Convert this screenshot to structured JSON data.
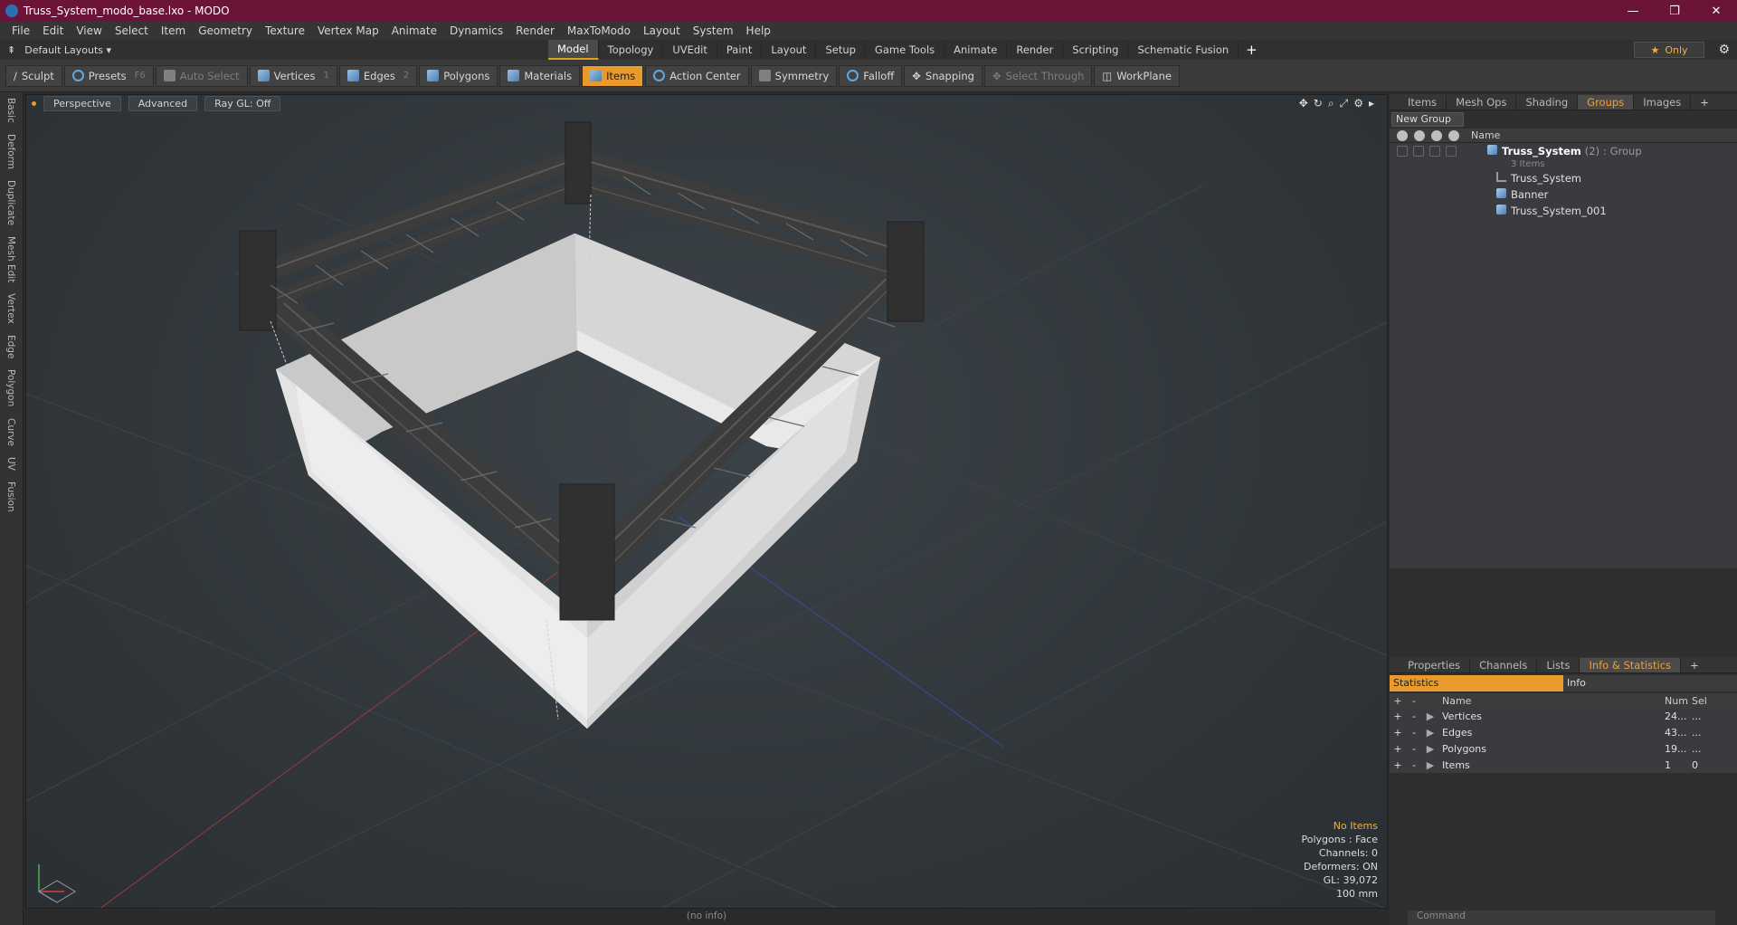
{
  "window": {
    "title": "Truss_System_modo_base.lxo - MODO",
    "minimize": "—",
    "maximize": "❐",
    "close": "✕"
  },
  "menu": [
    "File",
    "Edit",
    "View",
    "Select",
    "Item",
    "Geometry",
    "Texture",
    "Vertex Map",
    "Animate",
    "Dynamics",
    "Render",
    "MaxToModo",
    "Layout",
    "System",
    "Help"
  ],
  "layout": {
    "dropdown": "Default Layouts ▾",
    "tabs": [
      "Model",
      "Topology",
      "UVEdit",
      "Paint",
      "Layout",
      "Setup",
      "Game Tools",
      "Animate",
      "Render",
      "Scripting",
      "Schematic Fusion"
    ],
    "active_tab": "Model",
    "only_label": "Only"
  },
  "toolbar": {
    "sculpt": "Sculpt",
    "presets": "Presets",
    "presets_key": "F6",
    "auto_select": "Auto Select",
    "vertices": "Vertices",
    "vertices_n": "1",
    "edges": "Edges",
    "edges_n": "2",
    "polygons": "Polygons",
    "materials": "Materials",
    "items": "Items",
    "action_center": "Action Center",
    "symmetry": "Symmetry",
    "falloff": "Falloff",
    "snapping": "Snapping",
    "select_through": "Select Through",
    "workplane": "WorkPlane"
  },
  "side_tabs": [
    "Basic",
    "Deform",
    "Duplicate",
    "Mesh Edit",
    "Vertex",
    "Edge",
    "Polygon",
    "Curve",
    "UV",
    "Fusion"
  ],
  "viewport": {
    "view": "Perspective",
    "shading": "Advanced",
    "raygl": "Ray GL: Off",
    "overlay": {
      "no_items": "No Items",
      "polygons": "Polygons : Face",
      "channels": "Channels: 0",
      "deformers": "Deformers: ON",
      "gl": "GL: 39,072",
      "scale": "100 mm"
    },
    "status": "(no info)"
  },
  "groups_panel": {
    "tabs": [
      "Items",
      "Mesh Ops",
      "Shading",
      "Groups",
      "Images"
    ],
    "active": "Groups",
    "new_group": "New Group",
    "name_col": "Name",
    "group": {
      "name": "Truss_System",
      "count": "(2)",
      "type": ": Group",
      "note": "3 Items"
    },
    "children": [
      "Truss_System",
      "Banner",
      "Truss_System_001"
    ]
  },
  "props_panel": {
    "tabs": [
      "Properties",
      "Channels",
      "Lists",
      "Info & Statistics"
    ],
    "active": "Info & Statistics",
    "stat_tabs": [
      "Statistics",
      "Info"
    ],
    "columns": {
      "name": "Name",
      "num": "Num",
      "sel": "Sel"
    },
    "rows": [
      {
        "name": "Vertices",
        "num": "24...",
        "sel": "..."
      },
      {
        "name": "Edges",
        "num": "43...",
        "sel": "..."
      },
      {
        "name": "Polygons",
        "num": "19...",
        "sel": "..."
      },
      {
        "name": "Items",
        "num": "1",
        "sel": "0"
      }
    ]
  },
  "command": {
    "placeholder": "Command"
  },
  "colors": {
    "titlebar": "#6b1437",
    "accent": "#e89a2c",
    "viewport": "#30363a"
  }
}
